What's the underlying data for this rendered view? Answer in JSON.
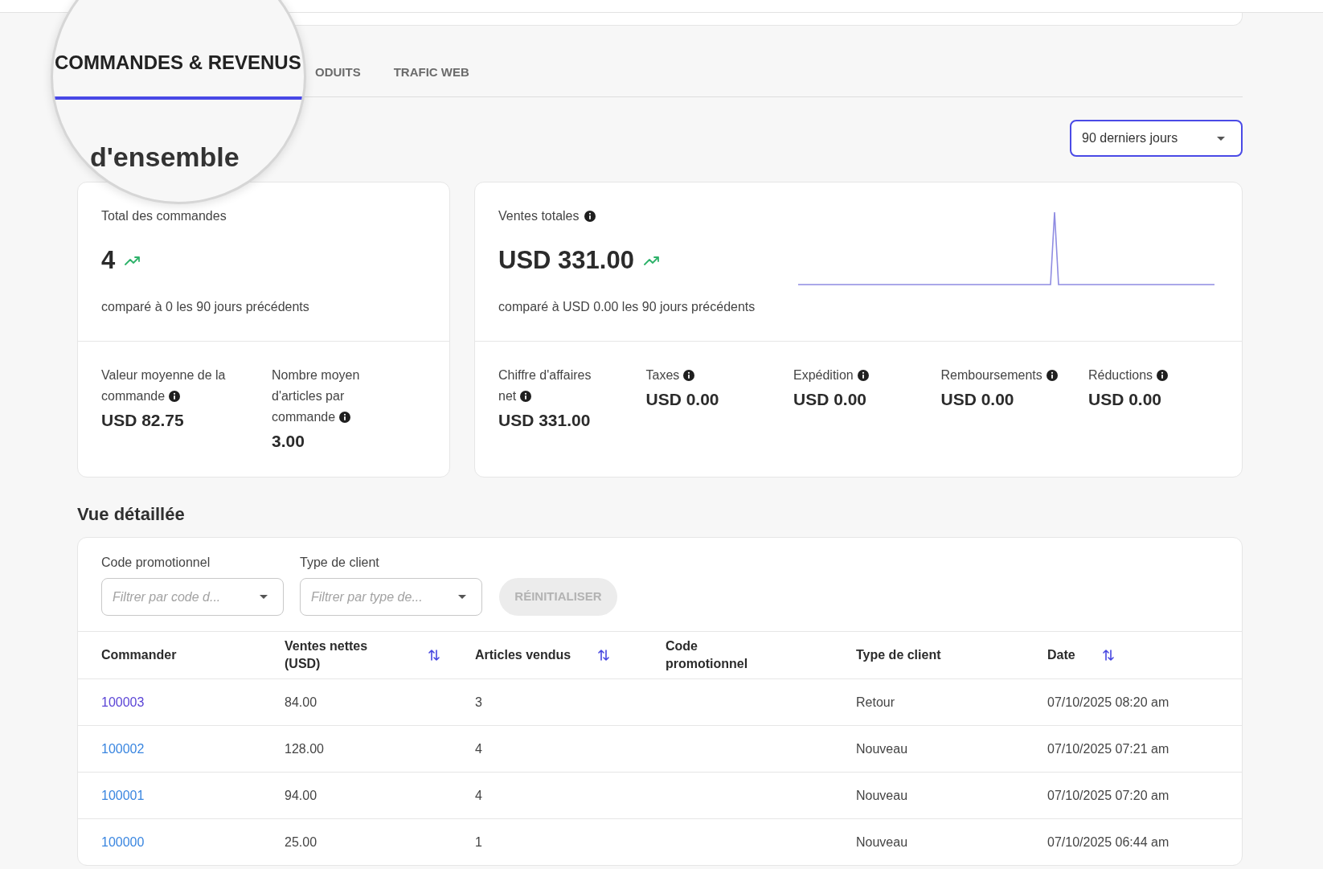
{
  "magnifier": {
    "tab": {
      "label": "COMMANDES & REVENUS",
      "selected": true
    },
    "heading": "d'ensemble"
  },
  "tabs": [
    {
      "label": "ODUITS",
      "selected": false
    },
    {
      "label": "TRAFIC WEB",
      "selected": false
    }
  ],
  "period_select": {
    "value": "90 derniers jours"
  },
  "orders_card": {
    "title": {
      "text": "Total des commandes",
      "info": false
    },
    "value": "4",
    "trend_up": true,
    "comparison": "comparé à 0 les 90 jours précédents",
    "metrics": [
      {
        "label": "Valeur moyenne de la commande",
        "info": true,
        "value": "USD 82.75"
      },
      {
        "label": "Nombre moyen d'articles par commande",
        "info": true,
        "value": "3.00"
      }
    ]
  },
  "sales_card": {
    "title": {
      "text": "Ventes totales",
      "info": true
    },
    "value": "USD 331.00",
    "trend_up": true,
    "comparison": "comparé à USD 0.00 les 90 jours précédents",
    "metrics": [
      {
        "label": "Chiffre d'affaires net",
        "info": true,
        "value": "USD 331.00"
      },
      {
        "label": "Taxes",
        "info": true,
        "value": "USD 0.00"
      },
      {
        "label": "Expédition",
        "info": true,
        "value": "USD 0.00"
      },
      {
        "label": "Remboursements",
        "info": true,
        "value": "USD 0.00"
      },
      {
        "label": "Réductions",
        "info": true,
        "value": "USD 0.00"
      }
    ]
  },
  "detail": {
    "title": "Vue détaillée",
    "filters": [
      {
        "label": "Code promotionnel",
        "placeholder": "Filtrer par code d..."
      },
      {
        "label": "Type de client",
        "placeholder": "Filtrer par type de..."
      }
    ],
    "reset_button": {
      "label": "RÉINITIALISER",
      "disabled": true
    },
    "table": {
      "columns": [
        {
          "label": "Commander",
          "sortable": false
        },
        {
          "label": "Ventes nettes (USD)",
          "sortable": true
        },
        {
          "label": "Articles vendus",
          "sortable": true
        },
        {
          "label": "Code promotionnel",
          "sortable": false
        },
        {
          "label": "Type de client",
          "sortable": false
        },
        {
          "label": "Date",
          "sortable": true
        }
      ],
      "rows": [
        {
          "order": "100003",
          "visited": true,
          "net_sales": "84.00",
          "items_sold": "3",
          "customer_type": "Retour",
          "date": "07/10/2025 08:20 am"
        },
        {
          "order": "100002",
          "visited": false,
          "net_sales": "128.00",
          "items_sold": "4",
          "customer_type": "Nouveau",
          "date": "07/10/2025 07:21 am"
        },
        {
          "order": "100001",
          "visited": false,
          "net_sales": "94.00",
          "items_sold": "4",
          "customer_type": "Nouveau",
          "date": "07/10/2025 07:20 am"
        },
        {
          "order": "100000",
          "visited": false,
          "net_sales": "25.00",
          "items_sold": "1",
          "customer_type": "Nouveau",
          "date": "07/10/2025 06:44 am"
        }
      ]
    }
  }
}
